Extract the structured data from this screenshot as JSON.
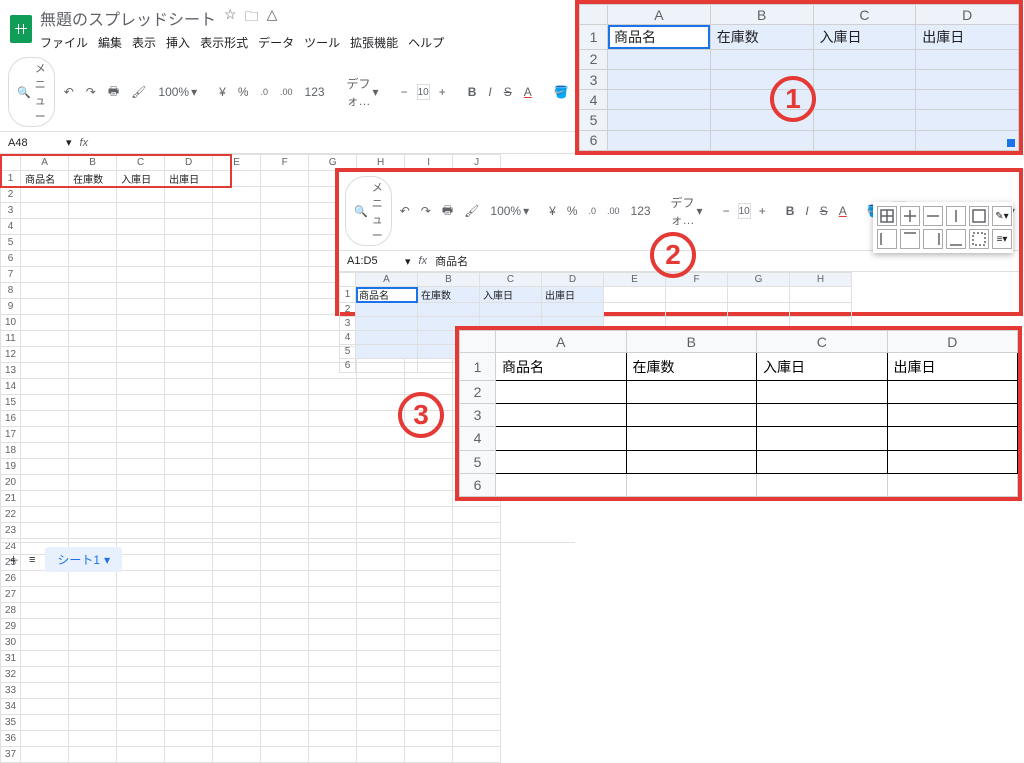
{
  "doc_title": "無題のスプレッドシート",
  "menubar": [
    "ファイル",
    "編集",
    "表示",
    "挿入",
    "表示形式",
    "データ",
    "ツール",
    "拡張機能",
    "ヘルプ"
  ],
  "toolbar": {
    "menu_btn": "メニュー",
    "zoom": "100%",
    "currency": "¥",
    "percent": "%",
    "dec_dec": ".0",
    "dec_inc": ".00",
    "numfmt": "123",
    "font": "デフォ…",
    "font_size": "10",
    "border_icon": "田"
  },
  "namebox_base": "A48",
  "formula_base": "",
  "base_sheet": {
    "cols": [
      "A",
      "B",
      "C",
      "D",
      "E",
      "F",
      "G",
      "H",
      "I",
      "J"
    ],
    "rows": 37,
    "headers": [
      "商品名",
      "在庫数",
      "入庫日",
      "出庫日"
    ]
  },
  "sheet_tab": "シート1",
  "callout1": {
    "cols": [
      "A",
      "B",
      "C",
      "D"
    ],
    "rows": [
      1,
      2,
      3,
      4,
      5,
      6
    ],
    "row1": [
      "商品名",
      "在庫数",
      "入庫日",
      "出庫日"
    ],
    "marker": "1"
  },
  "callout2": {
    "namebox": "A1:D5",
    "formula": "商品名",
    "cols": [
      "A",
      "B",
      "C",
      "D",
      "E",
      "F",
      "G",
      "H"
    ],
    "rows": [
      1,
      2,
      3,
      4,
      5,
      6
    ],
    "row1": [
      "商品名",
      "在庫数",
      "入庫日",
      "出庫日"
    ],
    "marker": "2"
  },
  "callout3": {
    "cols": [
      "A",
      "B",
      "C",
      "D"
    ],
    "rows": [
      1,
      2,
      3,
      4,
      5,
      6
    ],
    "row1": [
      "商品名",
      "在庫数",
      "入庫日",
      "出庫日"
    ],
    "marker": "3"
  }
}
